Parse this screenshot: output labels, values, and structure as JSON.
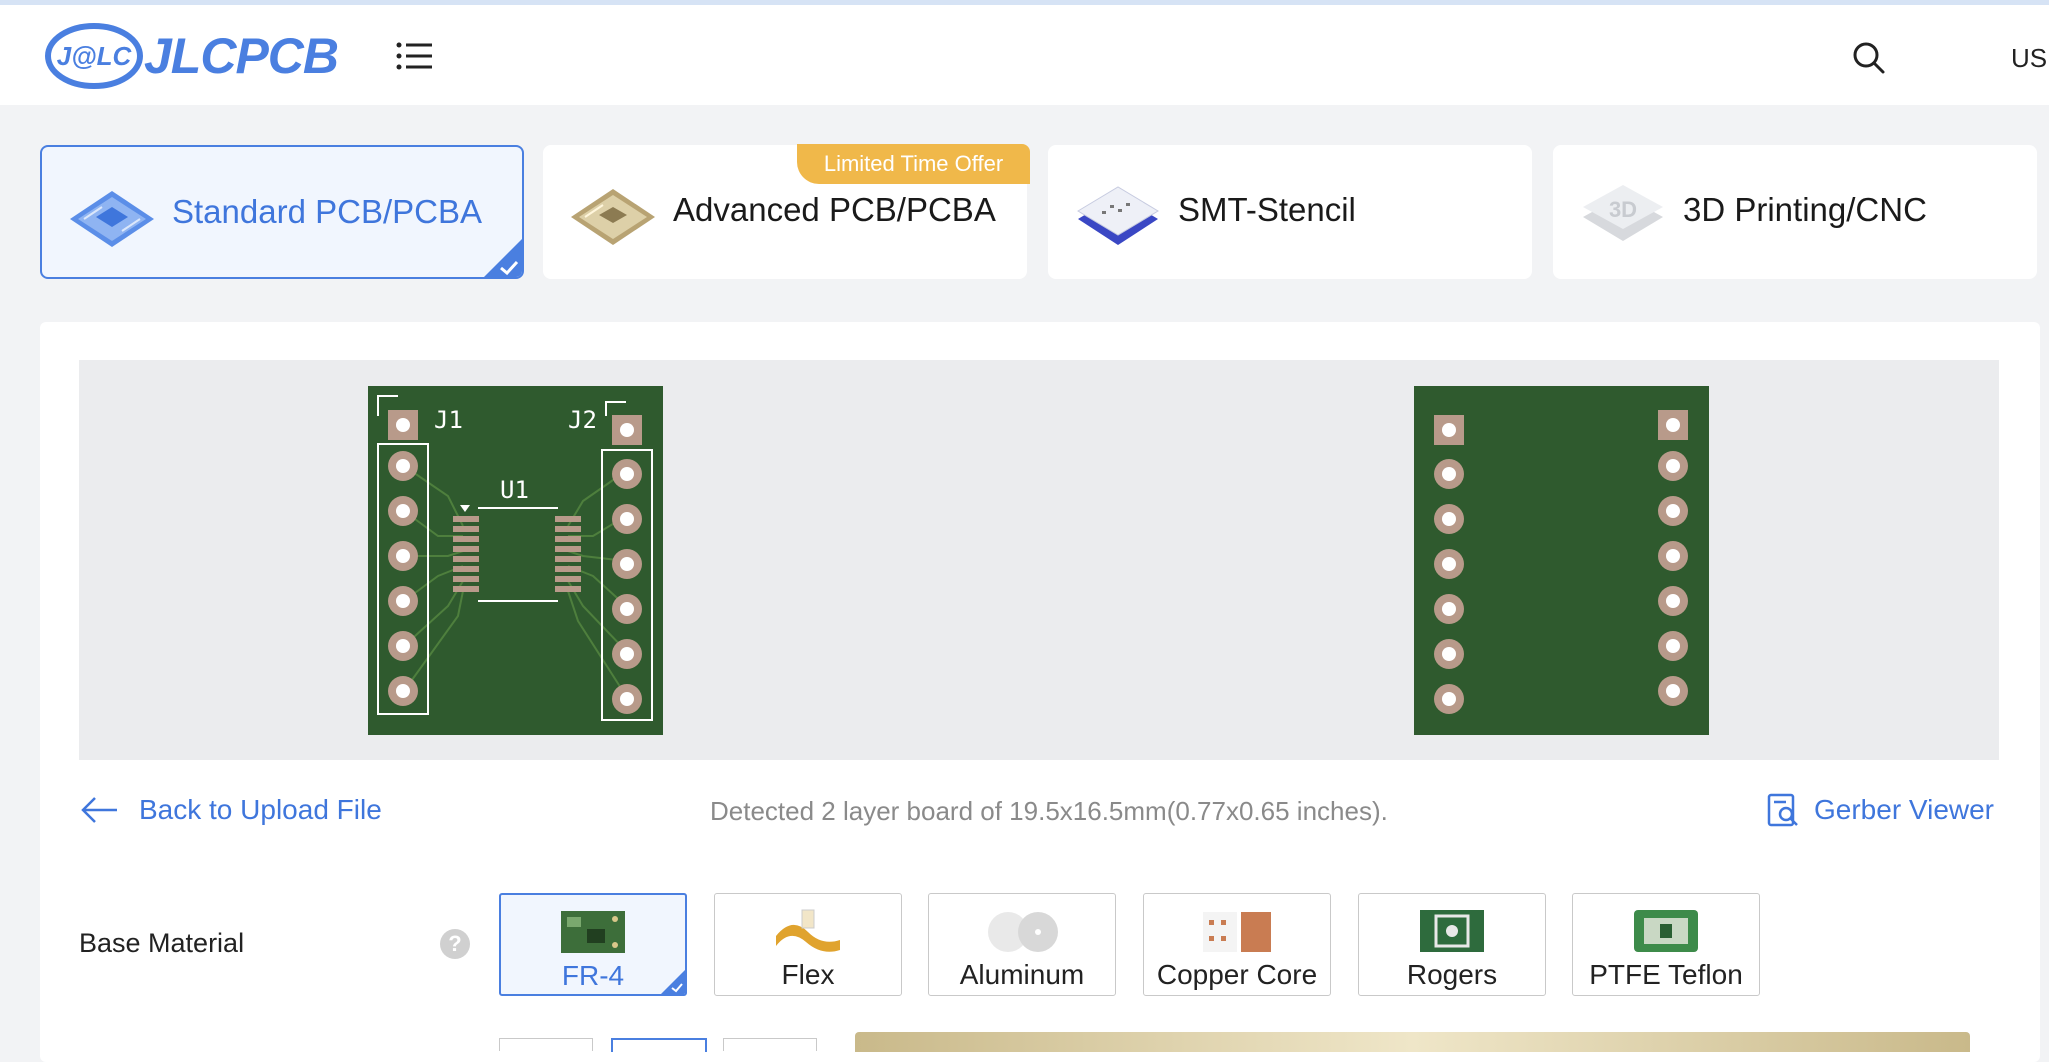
{
  "header": {
    "logo_text": "JLCPCB",
    "logo_badge": "J@LC",
    "language": "US"
  },
  "tabs": [
    {
      "label": "Standard PCB/PCBA",
      "active": true
    },
    {
      "label": "Advanced PCB/PCBA",
      "active": false,
      "badge": "Limited Time Offer"
    },
    {
      "label": "SMT-Stencil",
      "active": false
    },
    {
      "label": "3D Printing/CNC",
      "active": false
    }
  ],
  "preview": {
    "top_labels": {
      "j1": "J1",
      "j2": "J2",
      "u1": "U1"
    }
  },
  "actions": {
    "back": "Back to Upload File",
    "detected": "Detected 2 layer board of 19.5x16.5mm(0.77x0.65 inches).",
    "gerber": "Gerber Viewer"
  },
  "base_material": {
    "label": "Base Material",
    "help": "?",
    "options": [
      {
        "label": "FR-4",
        "selected": true
      },
      {
        "label": "Flex",
        "selected": false
      },
      {
        "label": "Aluminum",
        "selected": false
      },
      {
        "label": "Copper Core",
        "selected": false
      },
      {
        "label": "Rogers",
        "selected": false
      },
      {
        "label": "PTFE Teflon",
        "selected": false
      }
    ]
  },
  "colors": {
    "accent": "#4a7fe0",
    "board_green": "#2f5a2e",
    "pad": "#b89a8a",
    "offer": "#f0b84a"
  }
}
